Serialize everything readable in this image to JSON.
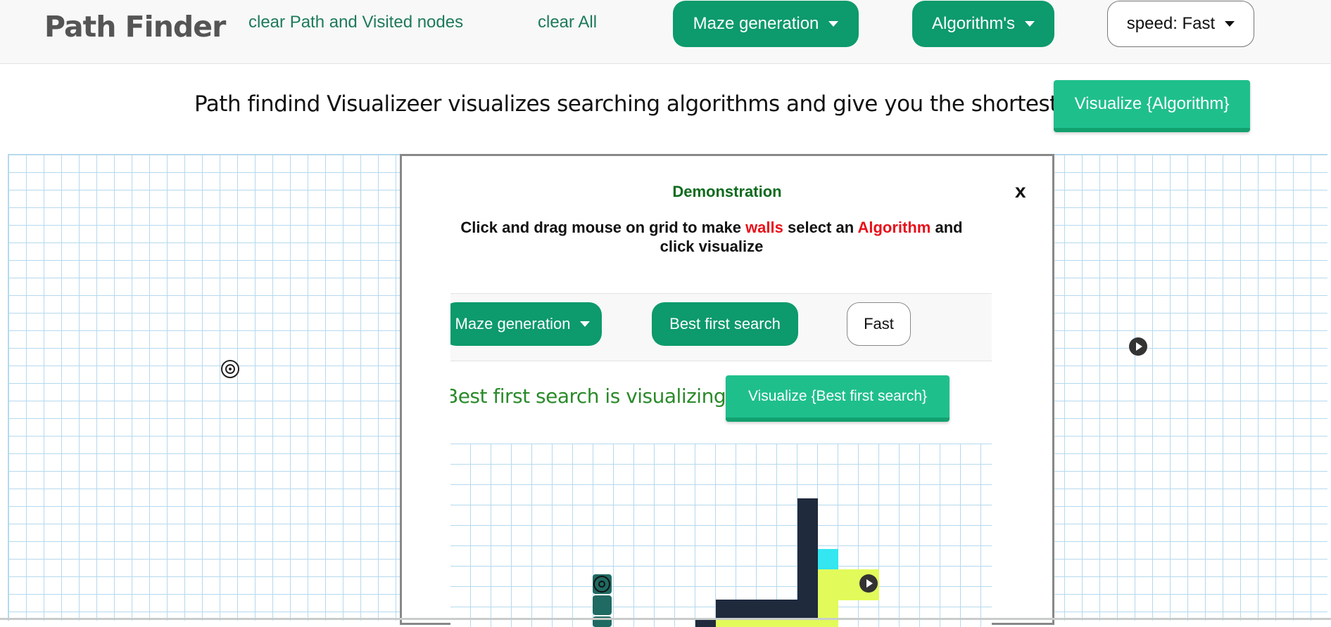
{
  "navbar": {
    "brand": "Path Finder",
    "clear_path_label": "clear Path and Visited nodes",
    "clear_all_label": "clear All",
    "maze_generation_label": "Maze generation",
    "algorithms_label": "Algorithm's",
    "speed_label": "speed: Fast"
  },
  "info": {
    "text": "Path findind Visualizeer visualizes searching algorithms and give you the shortest path.",
    "visualize_label": "Visualize {Algorithm}"
  },
  "grid": {
    "target_icon": "target-icon",
    "start_icon": "play-icon"
  },
  "modal": {
    "title": "Demonstration",
    "close_label": "x",
    "instructions": {
      "part1": "Click and drag mouse on grid to make ",
      "walls": "walls",
      "part2": " select an ",
      "algorithm": "Algorithm",
      "part3": " and click visualize"
    },
    "demo": {
      "maze_generation_label": "Maze generation",
      "algorithm_label": "Best first search",
      "speed_label": "Fast",
      "status": "Best first search is visualizing",
      "visualize_label": "Visualize {Best first search}"
    }
  },
  "colors": {
    "brand_green": "#0d9a6c",
    "visualize_green": "#1fbf8c",
    "grid_line": "#b5d9ee",
    "wall": "#1f2a3d",
    "visited": "#e2fa5a",
    "frontier": "#33e6f0",
    "path": "#1f6a62",
    "highlight_red": "#e8101a"
  }
}
